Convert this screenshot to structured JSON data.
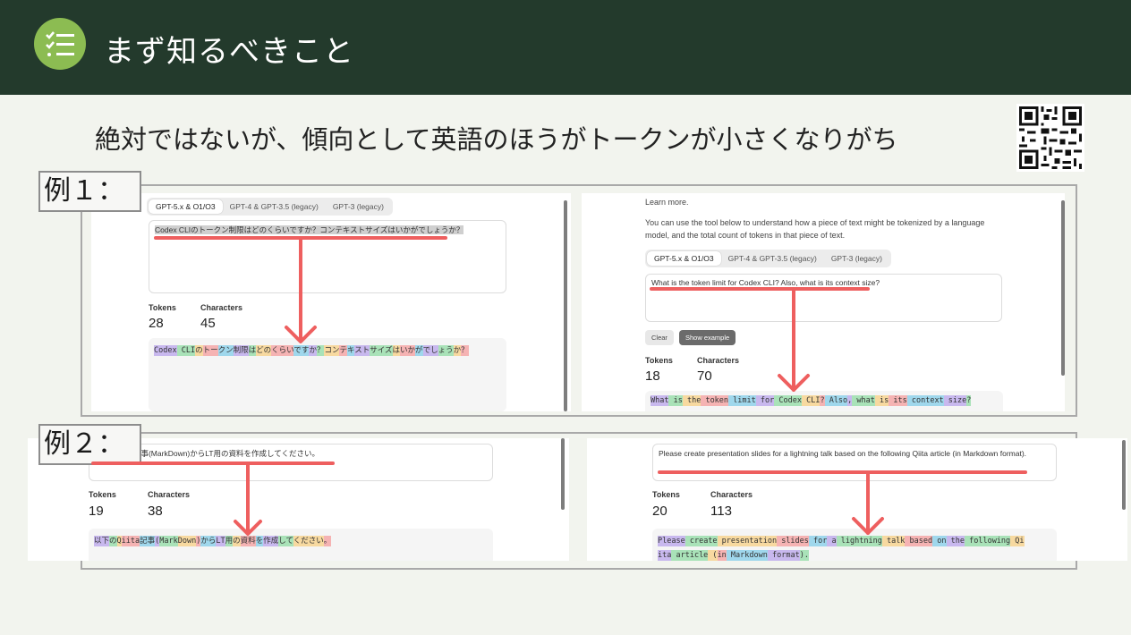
{
  "header": {
    "title": "まず知るべきこと",
    "icon": "checklist-icon"
  },
  "subtitle": "絶対ではないが、傾向として英語のほうがトークンが小さくなりがち",
  "example1": {
    "label": "例１：",
    "left": {
      "tabs": [
        "GPT-5.x & O1/O3",
        "GPT-4 & GPT-3.5 (legacy)",
        "GPT-3 (legacy)"
      ],
      "input_text": "Codex CLIのトークン制限はどのくらいですか？コンテキストサイズはいかがでしょうか？",
      "tokens_label": "Tokens",
      "tokens_value": "28",
      "chars_label": "Characters",
      "chars_value": "45",
      "tokenized": [
        "Codex",
        " CLI",
        "の",
        "トー",
        "クン",
        "制限",
        "は",
        "どの",
        "くらい",
        "です",
        "か",
        "？",
        "コン",
        "テ",
        "キ",
        "スト",
        "サイズ",
        "は",
        "いか",
        "が",
        "でし",
        "ょう",
        "か",
        "？"
      ]
    },
    "right": {
      "learn_more": "Learn more.",
      "description": "You can use the tool below to understand how a piece of text might be tokenized by a language model, and the total count of tokens in that piece of text.",
      "tabs": [
        "GPT-5.x & O1/O3",
        "GPT-4 & GPT-3.5 (legacy)",
        "GPT-3 (legacy)"
      ],
      "input_text": "What is the token limit for Codex CLI? Also, what is its context size?",
      "clear_label": "Clear",
      "show_example_label": "Show example",
      "tokens_label": "Tokens",
      "tokens_value": "18",
      "chars_label": "Characters",
      "chars_value": "70",
      "tokenized": [
        "What",
        " is",
        " the",
        " token",
        " limit",
        " for",
        " Codex",
        " CLI",
        "?",
        " Also",
        ",",
        " what",
        " is",
        " its",
        " context",
        " size",
        "?"
      ]
    }
  },
  "example2": {
    "label": "例２：",
    "left": {
      "input_text": "以下のQiita記事(MarkDown)からLT用の資料を作成してください。",
      "tokens_label": "Tokens",
      "tokens_value": "19",
      "chars_label": "Characters",
      "chars_value": "38",
      "tokenized": [
        "以下",
        "の",
        "Q",
        "iita",
        "記事",
        "(",
        "Mark",
        "Down",
        ")",
        "から",
        "LT",
        "用",
        "の",
        "資料",
        "を",
        "作成",
        "して",
        "ください",
        "。"
      ]
    },
    "right": {
      "input_text": "Please create presentation slides for a lightning talk based on the following Qiita article (in Markdown format).",
      "tokens_label": "Tokens",
      "tokens_value": "20",
      "chars_label": "Characters",
      "chars_value": "113",
      "tokenized_line1": [
        "Please",
        " create",
        " presentation",
        " slides",
        " for",
        " a",
        " lightning",
        " talk",
        " based",
        " on",
        " the",
        " following",
        " Qi"
      ],
      "tokenized_line2": [
        "ita",
        " article",
        " (",
        "in",
        " Markdown",
        " format",
        ")."
      ]
    }
  },
  "colors": {
    "header_bg": "#233a2c",
    "icon_bg": "#8cbc52",
    "arrow": "#ee5f5f",
    "token_palette": [
      "#c8b8ee",
      "#a9e2b8",
      "#f7d9a0",
      "#f5b3b3",
      "#9fd7ec"
    ]
  }
}
